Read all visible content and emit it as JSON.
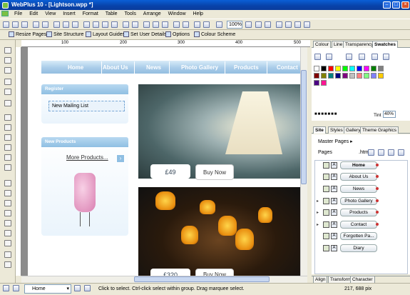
{
  "window": {
    "title": "WebPlus 10 - [Lightson.wpp *]",
    "min_icon": "minimize-icon",
    "max_icon": "maximize-icon",
    "close_icon": "close-icon"
  },
  "menu": [
    "File",
    "Edit",
    "View",
    "Insert",
    "Format",
    "Table",
    "Tools",
    "Arrange",
    "Window",
    "Help"
  ],
  "toolbar": {
    "zoom": "100%"
  },
  "toolbar2": {
    "resize_pages": "Resize Pages",
    "site_structure": "Site Structure",
    "layout_guides": "Layout Guides",
    "set_user_details": "Set User Details",
    "options": "Options",
    "colour_scheme": "Colour Scheme"
  },
  "ruler": {
    "ticks": [
      "100",
      "200",
      "300",
      "400",
      "500"
    ]
  },
  "webpage": {
    "nav": [
      "Home",
      "About Us",
      "News",
      "Photo Gallery",
      "Products",
      "Contact"
    ],
    "register_title": "Register",
    "mailing_list": "New Mailing List",
    "new_products_title": "New Products",
    "more_products": "More  Products...",
    "more_arrow": "›",
    "price1": "£49",
    "buy1": "Buy Now",
    "price2": "£320",
    "buy2": "Buy Now"
  },
  "colour_panel": {
    "tabs": [
      "Colour",
      "Line",
      "Transparency",
      "Swatches"
    ],
    "active_tab": "Swatches",
    "tint_label": "Tint",
    "tint_value": "40%",
    "swatches_row1": [
      "#ffffff",
      "#000000",
      "#ff0000",
      "#ffff00",
      "#00ff00",
      "#00ffff",
      "#0000ff",
      "#ff00ff",
      "#008000",
      "#808080"
    ],
    "swatches_row2": [
      "#800000",
      "#808000",
      "#008080",
      "#000080",
      "#800080",
      "#c0c0c0",
      "#ff8080",
      "#80ff80",
      "#8080ff",
      "#ffcc00"
    ],
    "swatches_row3": [
      "#4b0082",
      "#ff1493"
    ]
  },
  "site_panel": {
    "tabs": [
      "Site",
      "Styles",
      "Gallery",
      "Theme Graphics"
    ],
    "active_tab": "Site",
    "master_pages": "Master Pages ▸",
    "pages_label": "Pages",
    "html_label": ".html",
    "pages": [
      "Home",
      "About Us",
      "News",
      "Photo Gallery",
      "Products",
      "Contact",
      "Forgotten Pa...",
      "Diary"
    ]
  },
  "bottom_tabs": [
    "Align",
    "Transform",
    "Character"
  ],
  "status": {
    "page": "Home",
    "message": "Click to select. Ctrl-click select within group. Drag marquee select.",
    "coords": "217, 688 pix"
  }
}
